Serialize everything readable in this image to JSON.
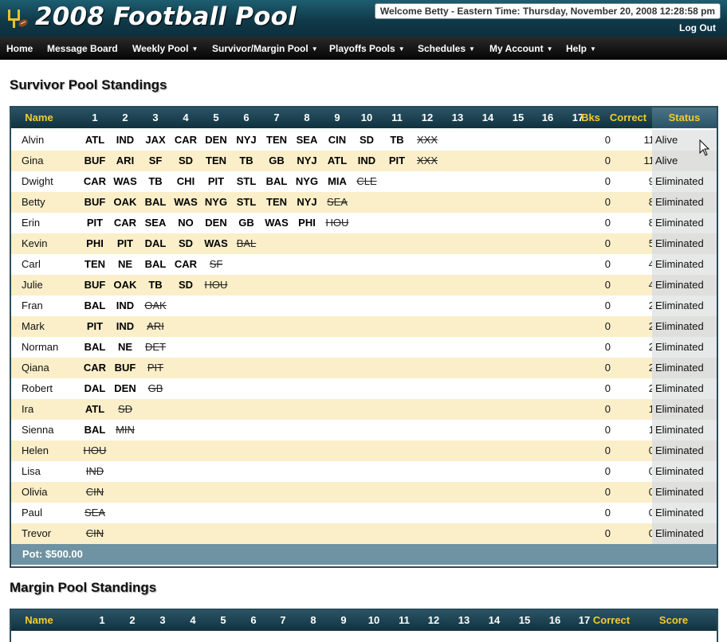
{
  "header": {
    "title": "2008 Football Pool",
    "welcome": "Welcome Betty - Eastern Time: Thursday, November 20, 2008 12:28:58 pm",
    "logout": "Log Out"
  },
  "nav": [
    {
      "label": "Home",
      "dropdown": false
    },
    {
      "label": "Message Board",
      "dropdown": false
    },
    {
      "label": "Weekly Pool",
      "dropdown": true
    },
    {
      "label": "Survivor/Margin Pool",
      "dropdown": true
    },
    {
      "label": "Playoffs Pools",
      "dropdown": true
    },
    {
      "label": "Schedules",
      "dropdown": true
    },
    {
      "label": "My Account",
      "dropdown": true
    },
    {
      "label": "Help",
      "dropdown": true
    }
  ],
  "survivor": {
    "title": "Survivor Pool Standings",
    "headers": {
      "name": "Name",
      "weeks": [
        "1",
        "2",
        "3",
        "4",
        "5",
        "6",
        "7",
        "8",
        "9",
        "10",
        "11",
        "12",
        "13",
        "14",
        "15",
        "16",
        "17"
      ],
      "bks": "Bks",
      "correct": "Correct",
      "status": "Status"
    },
    "rows": [
      {
        "name": "Alvin",
        "picks": [
          "ATL",
          "IND",
          "JAX",
          "CAR",
          "DEN",
          "NYJ",
          "TEN",
          "SEA",
          "CIN",
          "SD",
          "TB",
          "XXX"
        ],
        "lost": [
          11
        ],
        "bks": "0",
        "correct": "11",
        "status": "Alive"
      },
      {
        "name": "Gina",
        "picks": [
          "BUF",
          "ARI",
          "SF",
          "SD",
          "TEN",
          "TB",
          "GB",
          "NYJ",
          "ATL",
          "IND",
          "PIT",
          "XXX"
        ],
        "lost": [
          11
        ],
        "bks": "0",
        "correct": "11",
        "status": "Alive"
      },
      {
        "name": "Dwight",
        "picks": [
          "CAR",
          "WAS",
          "TB",
          "CHI",
          "PIT",
          "STL",
          "BAL",
          "NYG",
          "MIA",
          "CLE"
        ],
        "lost": [
          9
        ],
        "bks": "0",
        "correct": "9",
        "status": "Eliminated"
      },
      {
        "name": "Betty",
        "picks": [
          "BUF",
          "OAK",
          "BAL",
          "WAS",
          "NYG",
          "STL",
          "TEN",
          "NYJ",
          "SEA"
        ],
        "lost": [
          8
        ],
        "bks": "0",
        "correct": "8",
        "status": "Eliminated"
      },
      {
        "name": "Erin",
        "picks": [
          "PIT",
          "CAR",
          "SEA",
          "NO",
          "DEN",
          "GB",
          "WAS",
          "PHI",
          "HOU"
        ],
        "lost": [
          8
        ],
        "bks": "0",
        "correct": "8",
        "status": "Eliminated"
      },
      {
        "name": "Kevin",
        "picks": [
          "PHI",
          "PIT",
          "DAL",
          "SD",
          "WAS",
          "BAL"
        ],
        "lost": [
          5
        ],
        "bks": "0",
        "correct": "5",
        "status": "Eliminated"
      },
      {
        "name": "Carl",
        "picks": [
          "TEN",
          "NE",
          "BAL",
          "CAR",
          "SF"
        ],
        "lost": [
          4
        ],
        "bks": "0",
        "correct": "4",
        "status": "Eliminated"
      },
      {
        "name": "Julie",
        "picks": [
          "BUF",
          "OAK",
          "TB",
          "SD",
          "HOU"
        ],
        "lost": [
          4
        ],
        "bks": "0",
        "correct": "4",
        "status": "Eliminated"
      },
      {
        "name": "Fran",
        "picks": [
          "BAL",
          "IND",
          "OAK"
        ],
        "lost": [
          2
        ],
        "bks": "0",
        "correct": "2",
        "status": "Eliminated"
      },
      {
        "name": "Mark",
        "picks": [
          "PIT",
          "IND",
          "ARI"
        ],
        "lost": [
          2
        ],
        "bks": "0",
        "correct": "2",
        "status": "Eliminated"
      },
      {
        "name": "Norman",
        "picks": [
          "BAL",
          "NE",
          "DET"
        ],
        "lost": [
          2
        ],
        "bks": "0",
        "correct": "2",
        "status": "Eliminated"
      },
      {
        "name": "Qiana",
        "picks": [
          "CAR",
          "BUF",
          "PIT"
        ],
        "lost": [
          2
        ],
        "bks": "0",
        "correct": "2",
        "status": "Eliminated"
      },
      {
        "name": "Robert",
        "picks": [
          "DAL",
          "DEN",
          "GB"
        ],
        "lost": [
          2
        ],
        "bks": "0",
        "correct": "2",
        "status": "Eliminated"
      },
      {
        "name": "Ira",
        "picks": [
          "ATL",
          "SD"
        ],
        "lost": [
          1
        ],
        "bks": "0",
        "correct": "1",
        "status": "Eliminated"
      },
      {
        "name": "Sienna",
        "picks": [
          "BAL",
          "MIN"
        ],
        "lost": [
          1
        ],
        "bks": "0",
        "correct": "1",
        "status": "Eliminated"
      },
      {
        "name": "Helen",
        "picks": [
          "HOU"
        ],
        "lost": [
          0
        ],
        "bks": "0",
        "correct": "0",
        "status": "Eliminated"
      },
      {
        "name": "Lisa",
        "picks": [
          "IND"
        ],
        "lost": [
          0
        ],
        "bks": "0",
        "correct": "0",
        "status": "Eliminated"
      },
      {
        "name": "Olivia",
        "picks": [
          "CIN"
        ],
        "lost": [
          0
        ],
        "bks": "0",
        "correct": "0",
        "status": "Eliminated"
      },
      {
        "name": "Paul",
        "picks": [
          "SEA"
        ],
        "lost": [
          0
        ],
        "bks": "0",
        "correct": "0",
        "status": "Eliminated"
      },
      {
        "name": "Trevor",
        "picks": [
          "CIN"
        ],
        "lost": [
          0
        ],
        "bks": "0",
        "correct": "0",
        "status": "Eliminated"
      }
    ],
    "pot": "Pot: $500.00"
  },
  "margin": {
    "title": "Margin Pool Standings",
    "headers": {
      "name": "Name",
      "weeks": [
        "1",
        "2",
        "3",
        "4",
        "5",
        "6",
        "7",
        "8",
        "9",
        "10",
        "11",
        "12",
        "13",
        "14",
        "15",
        "16",
        "17"
      ],
      "correct": "Correct",
      "score": "Score"
    }
  },
  "colors": {
    "header_bg": "#174a5c",
    "nav_bg": "#111111",
    "gold_text": "#f2cb2e",
    "alt_row": "#fbefc9",
    "pot_bg": "#6f93a2"
  }
}
